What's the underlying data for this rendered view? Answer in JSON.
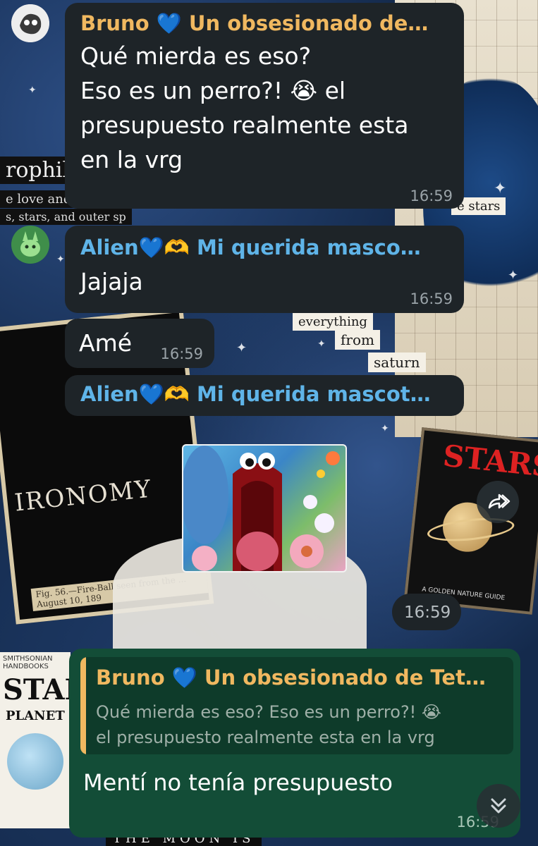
{
  "chat": {
    "messages": [
      {
        "sender": "Bruno 💙 Un obsesionado de…",
        "lines": [
          "Qué mierda es eso?",
          "Eso es un perro?! 😭 el",
          "presupuesto realmente esta",
          "en la vrg"
        ],
        "time": "16:59",
        "sender_color": "#f0b860"
      },
      {
        "sender": "Alien💙🫶 Mi querida masco…",
        "text": "Jajaja",
        "time": "16:59",
        "sender_color": "#5fb4e8"
      },
      {
        "text": "Amé",
        "time": "16:59"
      },
      {
        "sender": "Alien💙🫶 Mi querida mascot…",
        "media": "image-sticker",
        "time": "16:59",
        "sender_color": "#5fb4e8"
      }
    ],
    "reply": {
      "quoted_sender": "Bruno 💙 Un obsesionado de Tet…",
      "quoted_line1": "Qué mierda es eso? Eso es un perro?! 😭",
      "quoted_line2": "el presupuesto realmente esta en la vrg",
      "text": "Mentí no tenía presupuesto",
      "time": "16:59"
    }
  },
  "wallpaper": {
    "scraps": [
      "rophili",
      "e love and o",
      "s, stars, and outer sp",
      "e stars",
      "from",
      "saturn",
      "everything"
    ],
    "dark_card_word": "IRONOMY",
    "dark_card_caption": "Fig. 56.—Fire-Ball seen from the ... August 10, 189",
    "stars_book_title": "STARS",
    "stars_book_footer": "A GOLDEN NATURE GUIDE",
    "book_left_title": "STAR",
    "book_left_sub": "PLANET",
    "book_left_series": "SMITHSONIAN HANDBOOKS",
    "bottom_text": "THE MOON IS"
  },
  "icons": {
    "forward": "forward-icon",
    "scroll_down": "chevron-double-down-icon"
  },
  "colors": {
    "incoming_bubble": "#1e2428",
    "outgoing_bubble": "#134d37",
    "timestamp": "#9aa3a8"
  }
}
